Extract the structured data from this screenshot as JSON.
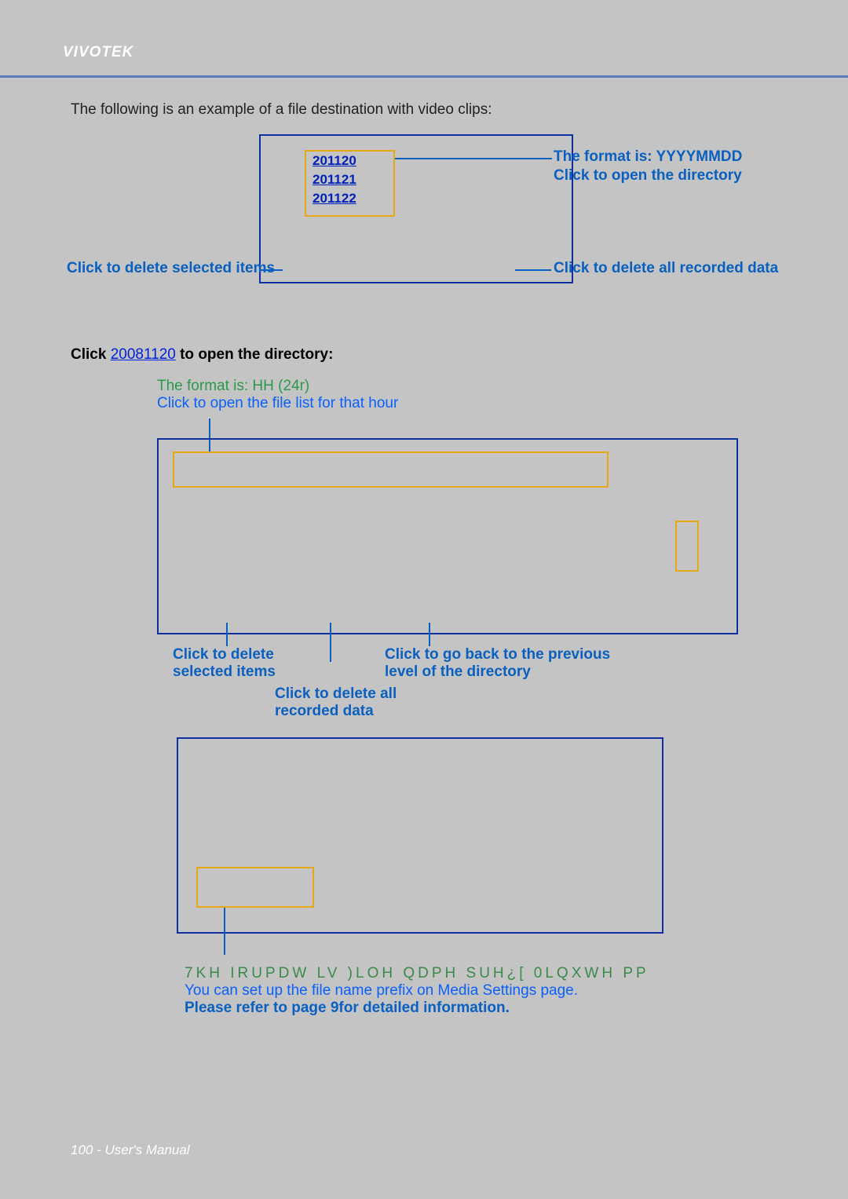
{
  "header": {
    "brand": "VIVOTEK"
  },
  "intro": "The following is an example of a file destination with video clips:",
  "diagram1": {
    "dates": [
      "201120",
      "201121",
      "201122"
    ],
    "labels": {
      "format": "The format is: YYYYMMDD",
      "open_dir": "Click to open the directory",
      "delete_selected": "Click to delete selected items",
      "delete_all": "Click to delete all recorded data"
    }
  },
  "section2": {
    "click": "Click",
    "linkdate": "20081120",
    "rest": " to open the directory:",
    "format": "The format is: HH (24r)",
    "open_file": "Click to open the file list for that hour"
  },
  "diagram2": {
    "labels": {
      "delete_selected_1": "Click to delete",
      "delete_selected_2": "selected items",
      "delete_all_1": "Click to delete all",
      "delete_all_2": "recorded data",
      "goback_1": "Click to go back to the previous",
      "goback_2": "level of the directory"
    }
  },
  "diagram3": {
    "encoded": "7KH  IRUPDW LV  )LOH  QDPH  SUH¿[   0LQXWH   PP",
    "note": "You can set up the file name prefix on Media Settings page.",
    "refer": "Please refer to page 9for detailed information."
  },
  "footer": {
    "text": "100 - User's Manual"
  }
}
